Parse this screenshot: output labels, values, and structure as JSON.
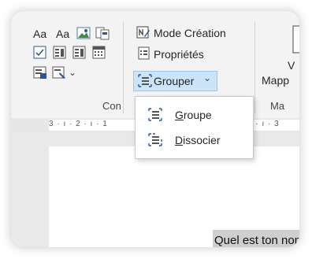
{
  "ribbon": {
    "style_text_1": "Aa",
    "style_text_2": "Aa",
    "mode_creation": "Mode Création",
    "proprietes": "Propriétés",
    "grouper": "Grouper",
    "group_caption": "Con",
    "mapp": "Mapp",
    "v_label": "V",
    "ma_caption": "Ma"
  },
  "menu": {
    "items": [
      {
        "mnemonic": "G",
        "rest": "roupe"
      },
      {
        "mnemonic": "D",
        "rest": "issocier"
      }
    ]
  },
  "ruler": {
    "left": "3 · ı · 2 · ı · 1",
    "right": "2 · ı · 3"
  },
  "document": {
    "selected_text": "Quel est ton nom ?"
  },
  "colors": {
    "accent_blue": "#2b579a",
    "highlight": "#cce4f7",
    "selection": "#cfcfcf"
  }
}
